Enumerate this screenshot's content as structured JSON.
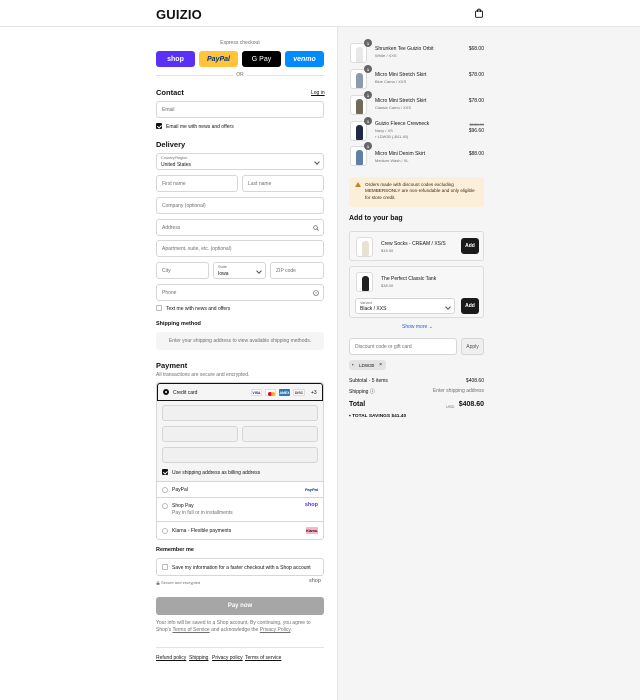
{
  "header": {
    "brand": "GUIZIO",
    "cart_icon": "shopping-bag-icon"
  },
  "express": {
    "label": "Express checkout",
    "buttons": [
      {
        "label": "shop",
        "color": "#5a31f4",
        "text_color": "#ffffff"
      },
      {
        "label": "PayPal",
        "color": "#ffc439",
        "text_color": "#003087"
      },
      {
        "label": "G Pay",
        "color": "#000000",
        "text_color": "#ffffff"
      },
      {
        "label": "venmo",
        "color": "#008cff",
        "text_color": "#ffffff"
      }
    ],
    "or": "OR"
  },
  "contact": {
    "title": "Contact",
    "login": "Log in",
    "email_placeholder": "Email",
    "newsletter": "Email me with news and offers",
    "newsletter_checked": true
  },
  "delivery": {
    "title": "Delivery",
    "country_label": "Country/Region",
    "country_value": "United States",
    "first_name": "First name",
    "last_name": "Last name",
    "company": "Company (optional)",
    "address": "Address",
    "apartment": "Apartment, suite, etc. (optional)",
    "city": "City",
    "state_label": "State",
    "state_value": "Iowa",
    "zip": "ZIP code",
    "phone": "Phone",
    "text_me": "Text me with news and offers"
  },
  "shipping": {
    "title": "Shipping method",
    "placeholder": "Enter your shipping address to view available shipping methods."
  },
  "payment": {
    "title": "Payment",
    "subtitle": "All transactions are secure and encrypted.",
    "credit_card": "Credit card",
    "card_brands": [
      "VISA",
      "MC",
      "AMEX",
      "DISC"
    ],
    "more_cards": "+3",
    "billing_same": "Use shipping address as billing address",
    "options": [
      {
        "label": "PayPal",
        "sub": "",
        "badge": "PayPal"
      },
      {
        "label": "Shop Pay",
        "sub": "Pay in full or in installments",
        "badge": "shop"
      },
      {
        "label": "Klarna - Flexible payments",
        "sub": "",
        "badge": "Klarna."
      }
    ]
  },
  "remember": {
    "title": "Remember me",
    "save_label": "Save my information for a faster checkout with a Shop account",
    "secure": "Secure and encrypted",
    "shop": "shop"
  },
  "pay_now": "Pay now",
  "legal": {
    "line1": "Your info will be saved to a Shop account. By continuing, you agree to Shop's",
    "terms": "Terms of Service",
    "and": "and acknowledge the",
    "privacy": "Privacy Policy",
    "period": "."
  },
  "footer_links": [
    "Refund policy",
    "Shipping",
    "Privacy policy",
    "Terms of service"
  ],
  "cart": {
    "items": [
      {
        "qty": "1",
        "name": "Shrunken Tee Guizio Orbit",
        "variant": "White / XXS",
        "price": "$68.00",
        "color": "#e8e8e8"
      },
      {
        "qty": "1",
        "name": "Micro Mini Stretch Skirt",
        "variant": "Blue Camo / XXS",
        "price": "$78.00",
        "color": "#8a9bb0"
      },
      {
        "qty": "1",
        "name": "Micro Mini Stretch Skirt",
        "variant": "Classic Camo / XXS",
        "price": "$78.00",
        "color": "#6f6a5a"
      },
      {
        "qty": "1",
        "name": "Guizio Fleece Crewneck",
        "variant": "Navy / XS",
        "discount": "LDW30 (-$41.40)",
        "old_price": "$138.00",
        "price": "$96.60",
        "color": "#1f2a44"
      },
      {
        "qty": "1",
        "name": "Micro Mini Denim Skirt",
        "variant": "Medium Wash / XL",
        "price": "$88.00",
        "color": "#5f7fa8"
      }
    ],
    "notice": "Orders made with discount codes excluding MEMBERSONLY are non-refundable and only eligible for store credit.",
    "add_title": "Add to your bag",
    "upsell": [
      {
        "name": "Crew Socks - CREAM / XS/S",
        "price": "$15.00",
        "add": "Add",
        "color": "#e7e1d2"
      },
      {
        "name": "The Perfect Classic Tank",
        "price": "$38.00",
        "add": "Add",
        "variant_label": "Variant",
        "variant_value": "Black / XXS",
        "color": "#222222"
      }
    ],
    "show_more": "Show more",
    "discount_placeholder": "Discount code or gift card",
    "apply": "Apply",
    "applied_code": "LDW30",
    "subtotal_label": "Subtotal · 5 items",
    "subtotal_value": "$408.60",
    "shipping_label": "Shipping",
    "shipping_value": "Enter shipping address",
    "total_label": "Total",
    "currency": "USD",
    "total_value": "$408.60",
    "savings_label": "TOTAL SAVINGS",
    "savings_value": "$41.40"
  }
}
